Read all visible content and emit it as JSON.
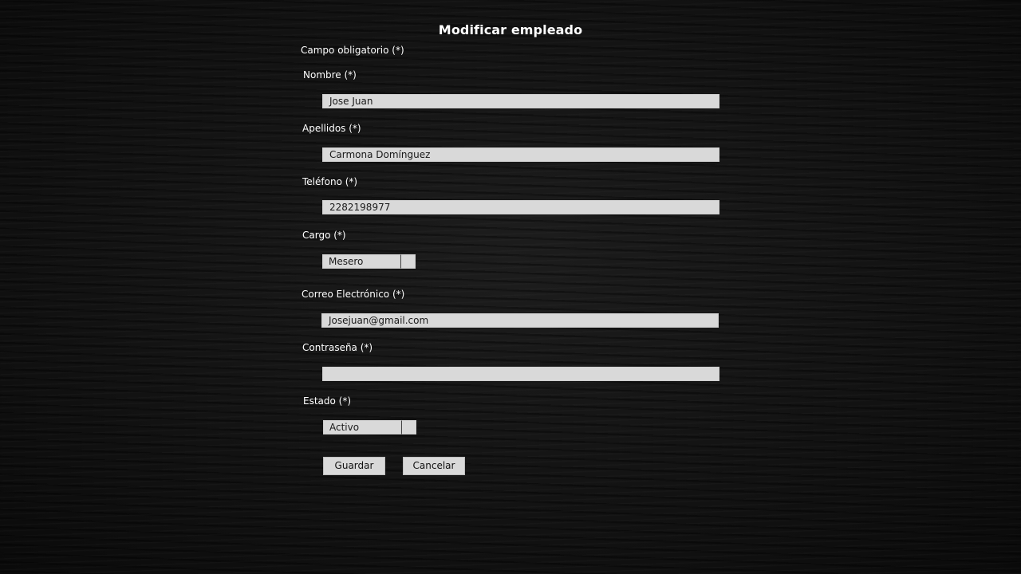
{
  "form": {
    "title": "Modificar empleado",
    "required_note": "Campo obligatorio (*)",
    "nombre": {
      "label": "Nombre (*)",
      "value": "Jose Juan"
    },
    "apellidos": {
      "label": "Apellidos (*)",
      "value": "Carmona Domínguez"
    },
    "telefono": {
      "label": "Teléfono (*)",
      "value": "2282198977"
    },
    "cargo": {
      "label": "Cargo (*)",
      "selected": "Mesero"
    },
    "correo": {
      "label": "Correo Electrónico (*)",
      "value": "Josejuan@gmail.com"
    },
    "contrasena": {
      "label": "Contraseña (*)",
      "value": ""
    },
    "estado": {
      "label": "Estado (*)",
      "selected": "Activo"
    },
    "guardar_label": "Guardar",
    "cancelar_label": "Cancelar"
  },
  "colors": {
    "background": "#121212",
    "input_fill": "#d9d9d9",
    "text_light": "#ffffff",
    "text_dark": "#1a1a1a"
  }
}
